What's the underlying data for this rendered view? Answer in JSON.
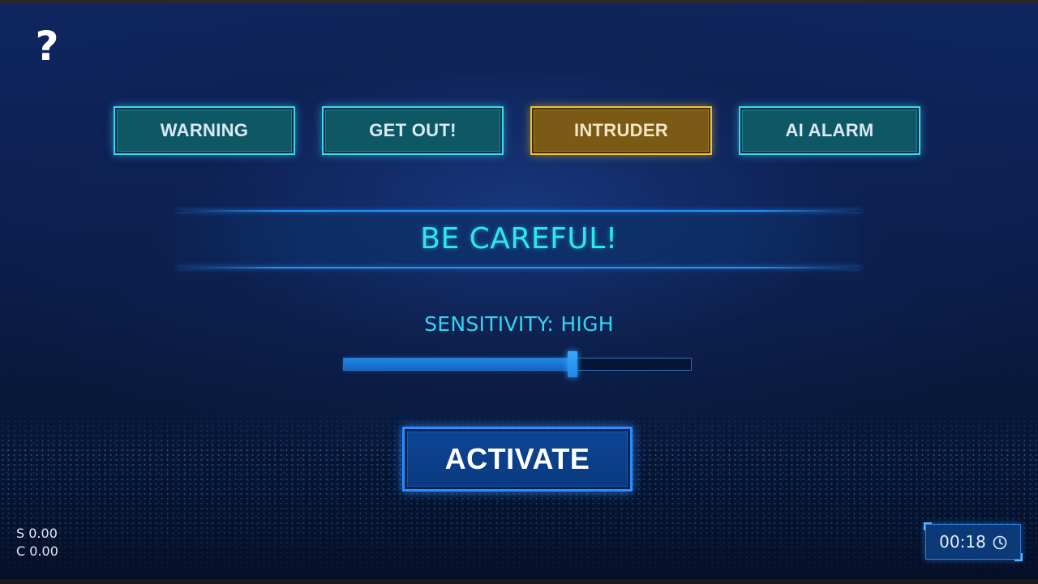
{
  "help": {
    "label": "?"
  },
  "tabs": [
    {
      "label": "WARNING",
      "selected": false
    },
    {
      "label": "GET OUT!",
      "selected": false
    },
    {
      "label": "INTRUDER",
      "selected": true
    },
    {
      "label": "AI ALARM",
      "selected": false
    }
  ],
  "message": {
    "text": "BE CAREFUL!"
  },
  "sensitivity": {
    "label": "SENSITIVITY: HIGH",
    "level": 0.66
  },
  "activate": {
    "label": "ACTIVATE"
  },
  "stats": {
    "s": "S 0.00",
    "c": "C 0.00"
  },
  "timer": {
    "text": "00:18",
    "icon": "clock-icon"
  },
  "colors": {
    "tab_accent": "#38d8ee",
    "tab_selected_accent": "#f0c22c",
    "message_text": "#2ee6f0",
    "activate_border": "#2a8cff"
  }
}
